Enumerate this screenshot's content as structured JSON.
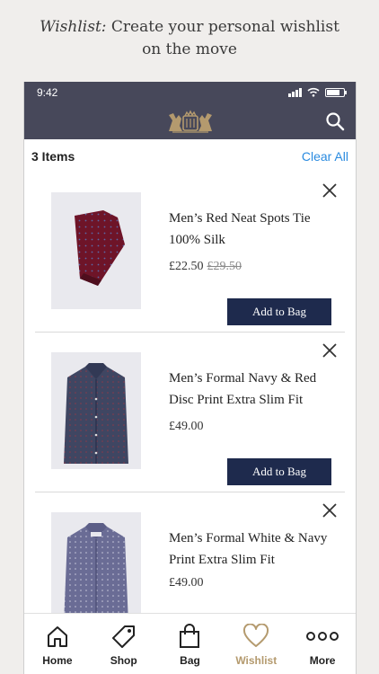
{
  "caption": {
    "lead": "Wishlist:",
    "text": "Create your personal wishlist",
    "line2": "on the move"
  },
  "status_bar": {
    "time": "9:42"
  },
  "header": {
    "search_icon": "search-icon",
    "logo_icon": "crest-logo"
  },
  "list": {
    "count_label": "3 Items",
    "clear_label": "Clear All"
  },
  "items": [
    {
      "title_line1": "Men’s Red Neat Spots Tie",
      "title_line2": "100% Silk",
      "price": "£22.50",
      "was_price": "£29.50",
      "button": "Add to Bag"
    },
    {
      "title_line1": "Men’s Formal Navy & Red",
      "title_line2": "Disc Print Extra Slim Fit",
      "price": "£49.00",
      "button": "Add to Bag"
    },
    {
      "title_line1": "Men’s Formal White & Navy",
      "title_line2": "Print Extra Slim Fit",
      "price": "£49.00"
    }
  ],
  "tabs": [
    {
      "label": "Home",
      "icon": "home-icon"
    },
    {
      "label": "Shop",
      "icon": "tag-icon"
    },
    {
      "label": "Bag",
      "icon": "bag-icon"
    },
    {
      "label": "Wishlist",
      "icon": "heart-icon",
      "active": true
    },
    {
      "label": "More",
      "icon": "more-icon"
    }
  ],
  "colors": {
    "header_bg": "#47485a",
    "button_bg": "#1e2a4d",
    "accent_link": "#2a8be0",
    "active_tab": "#b49a6e"
  }
}
